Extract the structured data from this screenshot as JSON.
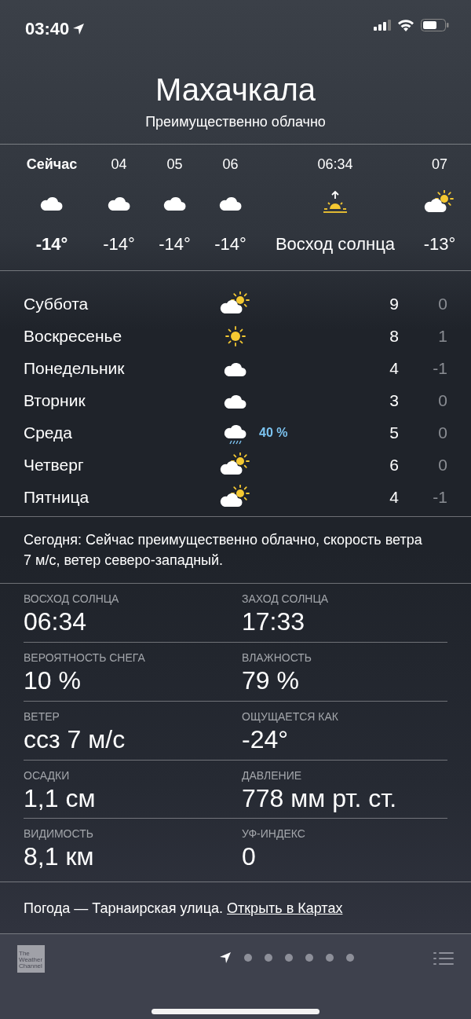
{
  "status_bar": {
    "time": "03:40"
  },
  "location": {
    "city": "Махачкала",
    "condition": "Преимущественно облачно"
  },
  "hourly": [
    {
      "kind": "cloud",
      "current": true,
      "time": "Сейчас",
      "temp": "-14°"
    },
    {
      "kind": "cloud",
      "current": false,
      "time": "04",
      "temp": "-14°"
    },
    {
      "kind": "cloud",
      "current": false,
      "time": "05",
      "temp": "-14°"
    },
    {
      "kind": "cloud",
      "current": false,
      "time": "06",
      "temp": "-14°"
    },
    {
      "kind": "sunrise",
      "current": false,
      "time": "06:34",
      "temp": "Восход солнца"
    },
    {
      "kind": "partlysunny",
      "current": false,
      "time": "07",
      "temp": "-13°"
    }
  ],
  "daily": [
    {
      "kind": "partlysunny",
      "day": "Суббота",
      "high": "9",
      "low": "0"
    },
    {
      "kind": "sun",
      "day": "Воскресенье",
      "high": "8",
      "low": "1"
    },
    {
      "kind": "cloud",
      "day": "Понедельник",
      "high": "4",
      "low": "-1"
    },
    {
      "kind": "cloud",
      "day": "Вторник",
      "high": "3",
      "low": "0"
    },
    {
      "kind": "rain",
      "day": "Среда",
      "precip": "40 %",
      "high": "5",
      "low": "0"
    },
    {
      "kind": "partlysunny",
      "day": "Четверг",
      "high": "6",
      "low": "0"
    },
    {
      "kind": "partlysunny",
      "day": "Пятница",
      "high": "4",
      "low": "-1"
    }
  ],
  "summary": "Сегодня: Сейчас преимущественно облачно, скорость ветра 7 м/с, ветер северо-западный.",
  "details": [
    {
      "label": "ВОСХОД СОЛНЦА",
      "value": "06:34"
    },
    {
      "label": "ЗАХОД СОЛНЦА",
      "value": "17:33"
    },
    {
      "label": "ВЕРОЯТНОСТЬ СНЕГА",
      "value": "10 %"
    },
    {
      "label": "ВЛАЖНОСТЬ",
      "value": "79 %"
    },
    {
      "label": "ВЕТЕР",
      "value": "ссз 7 м/с"
    },
    {
      "label": "ОЩУЩАЕТСЯ КАК",
      "value": "-24°"
    },
    {
      "label": "ОСАДКИ",
      "value": "1,1 см"
    },
    {
      "label": "ДАВЛЕНИЕ",
      "value": "778 мм рт. ст."
    },
    {
      "label": "ВИДИМОСТЬ",
      "value": "8,1 км"
    },
    {
      "label": "УФ-ИНДЕКС",
      "value": "0"
    }
  ],
  "footer": {
    "text": "Погода — Тарнаирская улица.",
    "link": "Открыть в Картах"
  },
  "bottom_bar": {
    "logo": "The Weather Channel",
    "pages": [
      {
        "kind": "location",
        "selected": true
      },
      {
        "kind": "dot",
        "selected": false
      },
      {
        "kind": "dot",
        "selected": false
      },
      {
        "kind": "dot",
        "selected": false
      },
      {
        "kind": "dot",
        "selected": false
      },
      {
        "kind": "dot",
        "selected": false
      },
      {
        "kind": "dot",
        "selected": false
      }
    ]
  }
}
